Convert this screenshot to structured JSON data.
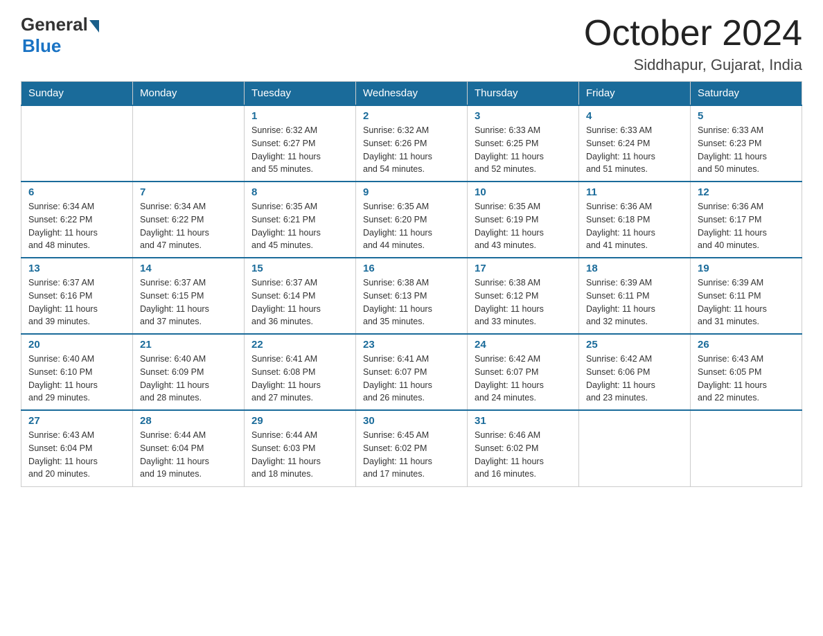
{
  "header": {
    "logo_general": "General",
    "logo_blue": "Blue",
    "month": "October 2024",
    "location": "Siddhapur, Gujarat, India"
  },
  "weekdays": [
    "Sunday",
    "Monday",
    "Tuesday",
    "Wednesday",
    "Thursday",
    "Friday",
    "Saturday"
  ],
  "weeks": [
    [
      {
        "day": "",
        "info": ""
      },
      {
        "day": "",
        "info": ""
      },
      {
        "day": "1",
        "info": "Sunrise: 6:32 AM\nSunset: 6:27 PM\nDaylight: 11 hours\nand 55 minutes."
      },
      {
        "day": "2",
        "info": "Sunrise: 6:32 AM\nSunset: 6:26 PM\nDaylight: 11 hours\nand 54 minutes."
      },
      {
        "day": "3",
        "info": "Sunrise: 6:33 AM\nSunset: 6:25 PM\nDaylight: 11 hours\nand 52 minutes."
      },
      {
        "day": "4",
        "info": "Sunrise: 6:33 AM\nSunset: 6:24 PM\nDaylight: 11 hours\nand 51 minutes."
      },
      {
        "day": "5",
        "info": "Sunrise: 6:33 AM\nSunset: 6:23 PM\nDaylight: 11 hours\nand 50 minutes."
      }
    ],
    [
      {
        "day": "6",
        "info": "Sunrise: 6:34 AM\nSunset: 6:22 PM\nDaylight: 11 hours\nand 48 minutes."
      },
      {
        "day": "7",
        "info": "Sunrise: 6:34 AM\nSunset: 6:22 PM\nDaylight: 11 hours\nand 47 minutes."
      },
      {
        "day": "8",
        "info": "Sunrise: 6:35 AM\nSunset: 6:21 PM\nDaylight: 11 hours\nand 45 minutes."
      },
      {
        "day": "9",
        "info": "Sunrise: 6:35 AM\nSunset: 6:20 PM\nDaylight: 11 hours\nand 44 minutes."
      },
      {
        "day": "10",
        "info": "Sunrise: 6:35 AM\nSunset: 6:19 PM\nDaylight: 11 hours\nand 43 minutes."
      },
      {
        "day": "11",
        "info": "Sunrise: 6:36 AM\nSunset: 6:18 PM\nDaylight: 11 hours\nand 41 minutes."
      },
      {
        "day": "12",
        "info": "Sunrise: 6:36 AM\nSunset: 6:17 PM\nDaylight: 11 hours\nand 40 minutes."
      }
    ],
    [
      {
        "day": "13",
        "info": "Sunrise: 6:37 AM\nSunset: 6:16 PM\nDaylight: 11 hours\nand 39 minutes."
      },
      {
        "day": "14",
        "info": "Sunrise: 6:37 AM\nSunset: 6:15 PM\nDaylight: 11 hours\nand 37 minutes."
      },
      {
        "day": "15",
        "info": "Sunrise: 6:37 AM\nSunset: 6:14 PM\nDaylight: 11 hours\nand 36 minutes."
      },
      {
        "day": "16",
        "info": "Sunrise: 6:38 AM\nSunset: 6:13 PM\nDaylight: 11 hours\nand 35 minutes."
      },
      {
        "day": "17",
        "info": "Sunrise: 6:38 AM\nSunset: 6:12 PM\nDaylight: 11 hours\nand 33 minutes."
      },
      {
        "day": "18",
        "info": "Sunrise: 6:39 AM\nSunset: 6:11 PM\nDaylight: 11 hours\nand 32 minutes."
      },
      {
        "day": "19",
        "info": "Sunrise: 6:39 AM\nSunset: 6:11 PM\nDaylight: 11 hours\nand 31 minutes."
      }
    ],
    [
      {
        "day": "20",
        "info": "Sunrise: 6:40 AM\nSunset: 6:10 PM\nDaylight: 11 hours\nand 29 minutes."
      },
      {
        "day": "21",
        "info": "Sunrise: 6:40 AM\nSunset: 6:09 PM\nDaylight: 11 hours\nand 28 minutes."
      },
      {
        "day": "22",
        "info": "Sunrise: 6:41 AM\nSunset: 6:08 PM\nDaylight: 11 hours\nand 27 minutes."
      },
      {
        "day": "23",
        "info": "Sunrise: 6:41 AM\nSunset: 6:07 PM\nDaylight: 11 hours\nand 26 minutes."
      },
      {
        "day": "24",
        "info": "Sunrise: 6:42 AM\nSunset: 6:07 PM\nDaylight: 11 hours\nand 24 minutes."
      },
      {
        "day": "25",
        "info": "Sunrise: 6:42 AM\nSunset: 6:06 PM\nDaylight: 11 hours\nand 23 minutes."
      },
      {
        "day": "26",
        "info": "Sunrise: 6:43 AM\nSunset: 6:05 PM\nDaylight: 11 hours\nand 22 minutes."
      }
    ],
    [
      {
        "day": "27",
        "info": "Sunrise: 6:43 AM\nSunset: 6:04 PM\nDaylight: 11 hours\nand 20 minutes."
      },
      {
        "day": "28",
        "info": "Sunrise: 6:44 AM\nSunset: 6:04 PM\nDaylight: 11 hours\nand 19 minutes."
      },
      {
        "day": "29",
        "info": "Sunrise: 6:44 AM\nSunset: 6:03 PM\nDaylight: 11 hours\nand 18 minutes."
      },
      {
        "day": "30",
        "info": "Sunrise: 6:45 AM\nSunset: 6:02 PM\nDaylight: 11 hours\nand 17 minutes."
      },
      {
        "day": "31",
        "info": "Sunrise: 6:46 AM\nSunset: 6:02 PM\nDaylight: 11 hours\nand 16 minutes."
      },
      {
        "day": "",
        "info": ""
      },
      {
        "day": "",
        "info": ""
      }
    ]
  ]
}
